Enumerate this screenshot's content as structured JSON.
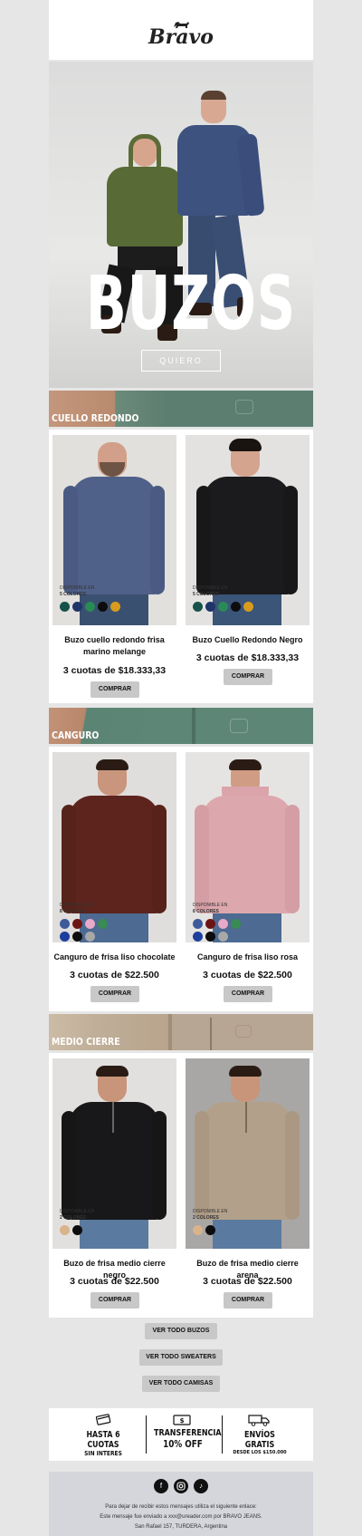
{
  "brand": {
    "logo": "Bravo"
  },
  "hero": {
    "title": "BUZOS",
    "button": "QUIERO"
  },
  "sections": [
    {
      "label": "CUELLO REDONDO",
      "banner_color": "#5c7e70",
      "products": [
        {
          "name": "Buzo cuello redondo frisa marino melange",
          "price": "3 cuotas de $18.333,33",
          "button": "COMPRAR",
          "avail_pre": "DISPONIBLE EN",
          "avail_count": "5 COLORES",
          "colors": [
            "#15524a",
            "#1f3468",
            "#2a8a55",
            "#0d0d0d",
            "#d89b1c"
          ]
        },
        {
          "name": "Buzo Cuello Redondo Negro",
          "price": "3 cuotas de $18.333,33",
          "button": "COMPRAR",
          "avail_pre": "DISPONIBLE EN",
          "avail_count": "5 COLORES",
          "colors": [
            "#15524a",
            "#1f3468",
            "#2a8a55",
            "#0d0d0d",
            "#d89b1c"
          ]
        }
      ]
    },
    {
      "label": "CANGURO",
      "banner_color": "#5e8677",
      "products": [
        {
          "name": "Canguro de frisa liso chocolate",
          "price": "3 cuotas de $22.500",
          "button": "COMPRAR",
          "avail_pre": "DISPONIBLE EN",
          "avail_count": "8 COLORES",
          "colors": [
            "#3d5a9a",
            "#6b1414",
            "#e9a9c8",
            "#3a8a54",
            "#1d3f9e",
            "#0d0d0d",
            "#a8a8a8"
          ]
        },
        {
          "name": "Canguro de frisa liso rosa",
          "price": "3 cuotas de $22.500",
          "button": "COMPRAR",
          "avail_pre": "DISPONIBLE EN",
          "avail_count": "8 COLORES",
          "colors": [
            "#3d5a9a",
            "#6b1414",
            "#e9a9c8",
            "#3a8a54",
            "#1d3f9e",
            "#0d0d0d",
            "#a8a8a8"
          ]
        }
      ]
    },
    {
      "label": "MEDIO CIERRE",
      "banner_color": "#b7a693",
      "products": [
        {
          "name": "Buzo de frisa medio cierre negro",
          "price": "3 cuotas de $22.500",
          "button": "COMPRAR",
          "avail_pre": "DISPONIBLE EN",
          "avail_count": "2 COLORES",
          "colors": [
            "#d9b38a",
            "#0d0d0d"
          ]
        },
        {
          "name": "Buzo de frisa medio cierre arena",
          "price": "3 cuotas de $22.500",
          "button": "COMPRAR",
          "avail_pre": "DISPONIBLE EN",
          "avail_count": "2 COLORES",
          "colors": [
            "#d9b38a",
            "#0d0d0d"
          ]
        }
      ]
    }
  ],
  "links": [
    "VER TODO BUZOS",
    "VER TODO SWEATERS",
    "VER TODO CAMISAS"
  ],
  "benefits": [
    {
      "line1": "HASTA 6 CUOTAS",
      "line2": "SIN INTERES"
    },
    {
      "line1": "TRANSFERENCIA",
      "line2": "10% OFF"
    },
    {
      "line1": "ENVÍOS GRATIS",
      "line2": "DESDE LOS $150.000"
    }
  ],
  "footer": {
    "line1": "Para dejar de recibir estos mensajes utiliza el siguiente enlace:",
    "line2": "Este mensaje fue enviado a xxx@ureader.com por BRAVO JEANS.",
    "line3": "San Rafael 157, TURDERA, Argentina"
  }
}
